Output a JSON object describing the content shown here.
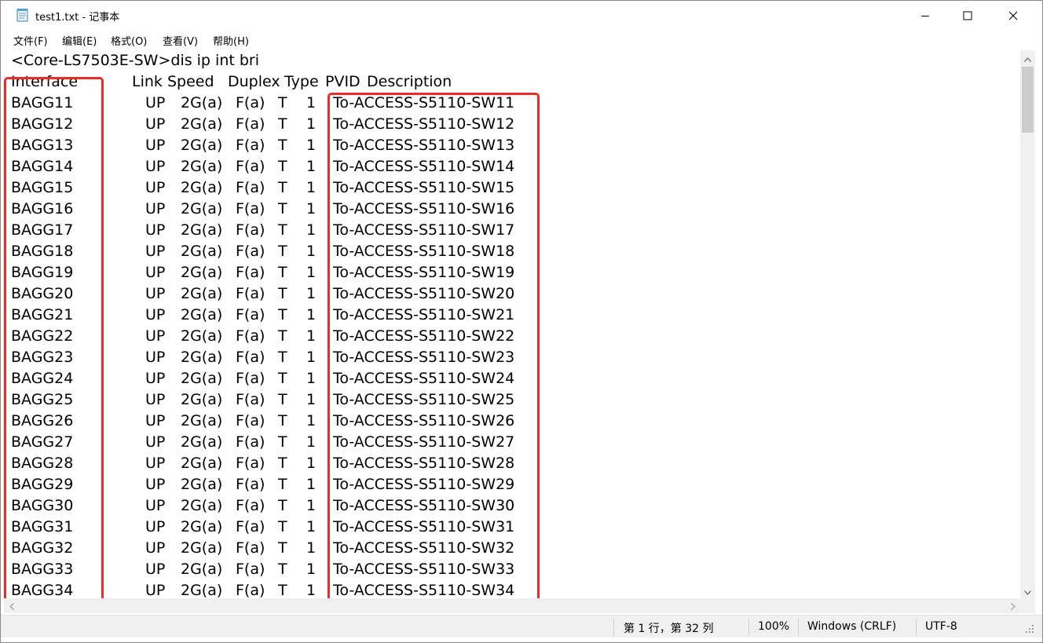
{
  "window": {
    "title": "test1.txt - 记事本"
  },
  "menu": [
    "文件(F)",
    "编辑(E)",
    "格式(O)",
    "查看(V)",
    "帮助(H)"
  ],
  "editor": {
    "command_line": "<Core-LS7503E-SW>dis ip int bri",
    "headers": {
      "interface": "Interface",
      "link_speed": "Link Speed",
      "duplex": "Duplex",
      "type": "Type",
      "pvid": "PVID",
      "description": "Description"
    },
    "rows": [
      {
        "interface": "BAGG11",
        "link": "UP",
        "speed": "2G(a)",
        "duplex": "F(a)",
        "type": "T",
        "pvid": "1",
        "description": "To-ACCESS-S5110-SW11"
      },
      {
        "interface": "BAGG12",
        "link": "UP",
        "speed": "2G(a)",
        "duplex": "F(a)",
        "type": "T",
        "pvid": "1",
        "description": "To-ACCESS-S5110-SW12"
      },
      {
        "interface": "BAGG13",
        "link": "UP",
        "speed": "2G(a)",
        "duplex": "F(a)",
        "type": "T",
        "pvid": "1",
        "description": "To-ACCESS-S5110-SW13"
      },
      {
        "interface": "BAGG14",
        "link": "UP",
        "speed": "2G(a)",
        "duplex": "F(a)",
        "type": "T",
        "pvid": "1",
        "description": "To-ACCESS-S5110-SW14"
      },
      {
        "interface": "BAGG15",
        "link": "UP",
        "speed": "2G(a)",
        "duplex": "F(a)",
        "type": "T",
        "pvid": "1",
        "description": "To-ACCESS-S5110-SW15"
      },
      {
        "interface": "BAGG16",
        "link": "UP",
        "speed": "2G(a)",
        "duplex": "F(a)",
        "type": "T",
        "pvid": "1",
        "description": "To-ACCESS-S5110-SW16"
      },
      {
        "interface": "BAGG17",
        "link": "UP",
        "speed": "2G(a)",
        "duplex": "F(a)",
        "type": "T",
        "pvid": "1",
        "description": "To-ACCESS-S5110-SW17"
      },
      {
        "interface": "BAGG18",
        "link": "UP",
        "speed": "2G(a)",
        "duplex": "F(a)",
        "type": "T",
        "pvid": "1",
        "description": "To-ACCESS-S5110-SW18"
      },
      {
        "interface": "BAGG19",
        "link": "UP",
        "speed": "2G(a)",
        "duplex": "F(a)",
        "type": "T",
        "pvid": "1",
        "description": "To-ACCESS-S5110-SW19"
      },
      {
        "interface": "BAGG20",
        "link": "UP",
        "speed": "2G(a)",
        "duplex": "F(a)",
        "type": "T",
        "pvid": "1",
        "description": "To-ACCESS-S5110-SW20"
      },
      {
        "interface": "BAGG21",
        "link": "UP",
        "speed": "2G(a)",
        "duplex": "F(a)",
        "type": "T",
        "pvid": "1",
        "description": "To-ACCESS-S5110-SW21"
      },
      {
        "interface": "BAGG22",
        "link": "UP",
        "speed": "2G(a)",
        "duplex": "F(a)",
        "type": "T",
        "pvid": "1",
        "description": "To-ACCESS-S5110-SW22"
      },
      {
        "interface": "BAGG23",
        "link": "UP",
        "speed": "2G(a)",
        "duplex": "F(a)",
        "type": "T",
        "pvid": "1",
        "description": "To-ACCESS-S5110-SW23"
      },
      {
        "interface": "BAGG24",
        "link": "UP",
        "speed": "2G(a)",
        "duplex": "F(a)",
        "type": "T",
        "pvid": "1",
        "description": "To-ACCESS-S5110-SW24"
      },
      {
        "interface": "BAGG25",
        "link": "UP",
        "speed": "2G(a)",
        "duplex": "F(a)",
        "type": "T",
        "pvid": "1",
        "description": "To-ACCESS-S5110-SW25"
      },
      {
        "interface": "BAGG26",
        "link": "UP",
        "speed": "2G(a)",
        "duplex": "F(a)",
        "type": "T",
        "pvid": "1",
        "description": "To-ACCESS-S5110-SW26"
      },
      {
        "interface": "BAGG27",
        "link": "UP",
        "speed": "2G(a)",
        "duplex": "F(a)",
        "type": "T",
        "pvid": "1",
        "description": "To-ACCESS-S5110-SW27"
      },
      {
        "interface": "BAGG28",
        "link": "UP",
        "speed": "2G(a)",
        "duplex": "F(a)",
        "type": "T",
        "pvid": "1",
        "description": "To-ACCESS-S5110-SW28"
      },
      {
        "interface": "BAGG29",
        "link": "UP",
        "speed": "2G(a)",
        "duplex": "F(a)",
        "type": "T",
        "pvid": "1",
        "description": "To-ACCESS-S5110-SW29"
      },
      {
        "interface": "BAGG30",
        "link": "UP",
        "speed": "2G(a)",
        "duplex": "F(a)",
        "type": "T",
        "pvid": "1",
        "description": "To-ACCESS-S5110-SW30"
      },
      {
        "interface": "BAGG31",
        "link": "UP",
        "speed": "2G(a)",
        "duplex": "F(a)",
        "type": "T",
        "pvid": "1",
        "description": "To-ACCESS-S5110-SW31"
      },
      {
        "interface": "BAGG32",
        "link": "UP",
        "speed": "2G(a)",
        "duplex": "F(a)",
        "type": "T",
        "pvid": "1",
        "description": "To-ACCESS-S5110-SW32"
      },
      {
        "interface": "BAGG33",
        "link": "UP",
        "speed": "2G(a)",
        "duplex": "F(a)",
        "type": "T",
        "pvid": "1",
        "description": "To-ACCESS-S5110-SW33"
      },
      {
        "interface": "BAGG34",
        "link": "UP",
        "speed": "2G(a)",
        "duplex": "F(a)",
        "type": "T",
        "pvid": "1",
        "description": "To-ACCESS-S5110-SW34"
      }
    ]
  },
  "highlight_color": "#ee2a2a",
  "statusbar": {
    "position": "第 1 行，第 32 列",
    "zoom": "100%",
    "line_ending": "Windows (CRLF)",
    "encoding": "UTF-8"
  },
  "icons": {
    "app": "notepad-icon",
    "minimize": "minimize-icon",
    "maximize": "maximize-icon",
    "close": "close-icon"
  }
}
